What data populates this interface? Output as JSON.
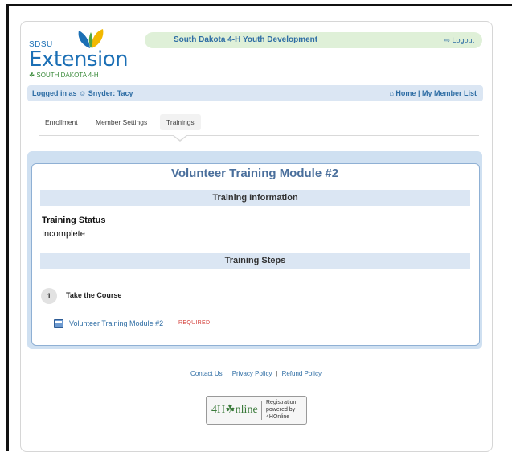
{
  "header": {
    "logo": {
      "line1": "SDSU",
      "line2": "Extension",
      "line3": "☘ SOUTH DAKOTA 4-H"
    },
    "title": "South Dakota 4-H Youth Development",
    "logout": "⇨ Logout"
  },
  "loggedbar": {
    "text": "Logged in as ☺ Snyder: Tacy",
    "home": "⌂ Home",
    "separator": "|",
    "member_list": "My Member List"
  },
  "tabs": [
    {
      "label": "Enrollment"
    },
    {
      "label": "Member Settings"
    },
    {
      "label": "Trainings"
    }
  ],
  "module": {
    "title": "Volunteer Training Module #2",
    "info_header": "Training Information",
    "status_label": "Training Status",
    "status_value": "Incomplete",
    "steps_header": "Training Steps",
    "step": {
      "number": "1",
      "label": "Take the Course",
      "course_link": "Volunteer Training Module #2",
      "required": "REQUIRED"
    }
  },
  "footer": {
    "links": [
      "Contact Us",
      "Privacy Policy",
      "Refund Policy"
    ],
    "separator": "|",
    "badge": {
      "logo": "4H☘nline",
      "line1": "Registration",
      "line2": "powered by",
      "line3": "4HOnline"
    }
  },
  "colors": {
    "accent": "#2e6da4",
    "banner_bg": "#dff0d8",
    "section_bg": "#dbe6f3",
    "required": "#d43f3a"
  }
}
